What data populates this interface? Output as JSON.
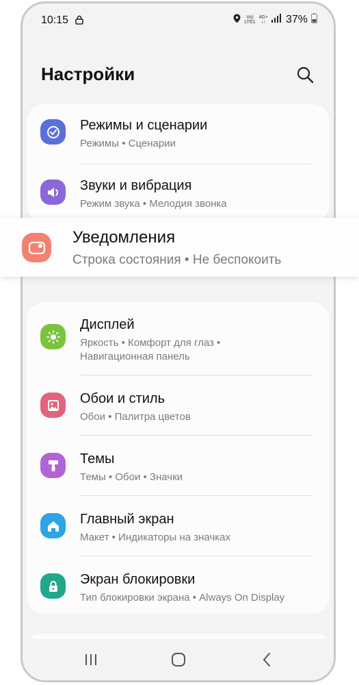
{
  "status": {
    "time": "10:15",
    "volte_top": "Vo)",
    "volte_bottom": "LTE1",
    "network": "4G+",
    "battery": "37%"
  },
  "header": {
    "title": "Настройки"
  },
  "groups": [
    {
      "items": [
        {
          "title": "Режимы и сценарии",
          "subtitle": "Режимы  •  Сценарии",
          "icon": "modes-icon",
          "color": "#5a6fd8"
        },
        {
          "title": "Звуки и вибрация",
          "subtitle": "Режим звука  •  Мелодия звонка",
          "icon": "sound-icon",
          "color": "#8a68d9"
        }
      ]
    },
    {
      "items": [
        {
          "title": "Дисплей",
          "subtitle": "Яркость  •  Комфорт для глаз  •",
          "subtitle2": "Навигационная панель",
          "icon": "display-icon",
          "color": "#7ac43c"
        },
        {
          "title": "Обои и стиль",
          "subtitle": "Обои  •  Палитра цветов",
          "icon": "wallpaper-icon",
          "color": "#e2637f"
        },
        {
          "title": "Темы",
          "subtitle": "Темы  •  Обои  •  Значки",
          "icon": "themes-icon",
          "color": "#b065d6"
        },
        {
          "title": "Главный экран",
          "subtitle": "Макет  •  Индикаторы на значках",
          "icon": "home-icon",
          "color": "#2ea3e6"
        },
        {
          "title": "Экран блокировки",
          "subtitle": "Тип блокировки экрана  •  Always On Display",
          "icon": "lock-icon",
          "color": "#23a78a"
        }
      ]
    }
  ],
  "highlight": {
    "title": "Уведомления",
    "subtitle": "Строка состояния  •  Не беспокоить",
    "icon": "notifications-icon",
    "color": "#f0826f"
  }
}
